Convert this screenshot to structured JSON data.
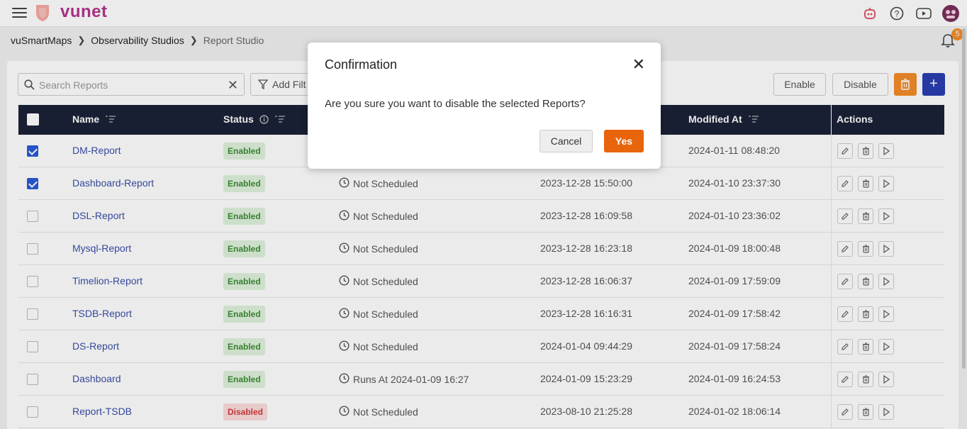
{
  "app": {
    "logo_text": "vunet"
  },
  "breadcrumb": [
    "vuSmartMaps",
    "Observability Studios",
    "Report Studio"
  ],
  "notifications": {
    "count": "5"
  },
  "toolbar": {
    "search_placeholder": "Search Reports",
    "filter_label": "Add Filt",
    "enable_label": "Enable",
    "disable_label": "Disable",
    "add_label": "+"
  },
  "table": {
    "headers": {
      "name": "Name",
      "status": "Status",
      "modified": "Modified At",
      "actions": "Actions"
    },
    "rows": [
      {
        "checked": true,
        "name": "DM-Report",
        "status": "Enabled",
        "schedule": "",
        "created": "",
        "modified": "2024-01-11 08:48:20"
      },
      {
        "checked": true,
        "name": "Dashboard-Report",
        "status": "Enabled",
        "schedule": "Not Scheduled",
        "created": "2023-12-28 15:50:00",
        "modified": "2024-01-10 23:37:30"
      },
      {
        "checked": false,
        "name": "DSL-Report",
        "status": "Enabled",
        "schedule": "Not Scheduled",
        "created": "2023-12-28 16:09:58",
        "modified": "2024-01-10 23:36:02"
      },
      {
        "checked": false,
        "name": "Mysql-Report",
        "status": "Enabled",
        "schedule": "Not Scheduled",
        "created": "2023-12-28 16:23:18",
        "modified": "2024-01-09 18:00:48"
      },
      {
        "checked": false,
        "name": "Timelion-Report",
        "status": "Enabled",
        "schedule": "Not Scheduled",
        "created": "2023-12-28 16:06:37",
        "modified": "2024-01-09 17:59:09"
      },
      {
        "checked": false,
        "name": "TSDB-Report",
        "status": "Enabled",
        "schedule": "Not Scheduled",
        "created": "2023-12-28 16:16:31",
        "modified": "2024-01-09 17:58:42"
      },
      {
        "checked": false,
        "name": "DS-Report",
        "status": "Enabled",
        "schedule": "Not Scheduled",
        "created": "2024-01-04 09:44:29",
        "modified": "2024-01-09 17:58:24"
      },
      {
        "checked": false,
        "name": "Dashboard",
        "status": "Enabled",
        "schedule": "Runs At 2024-01-09 16:27",
        "created": "2024-01-09 15:23:29",
        "modified": "2024-01-09 16:24:53"
      },
      {
        "checked": false,
        "name": "Report-TSDB",
        "status": "Disabled",
        "schedule": "Not Scheduled",
        "created": "2023-08-10 21:25:28",
        "modified": "2024-01-02 18:06:14"
      }
    ]
  },
  "modal": {
    "title": "Confirmation",
    "message": "Are you sure you want to disable the selected Reports?",
    "cancel_label": "Cancel",
    "yes_label": "Yes"
  },
  "colors": {
    "brand": "#b5358f",
    "accent_orange": "#e8650c",
    "primary_blue": "#2a3eb1",
    "header_dark": "#1c2238"
  }
}
